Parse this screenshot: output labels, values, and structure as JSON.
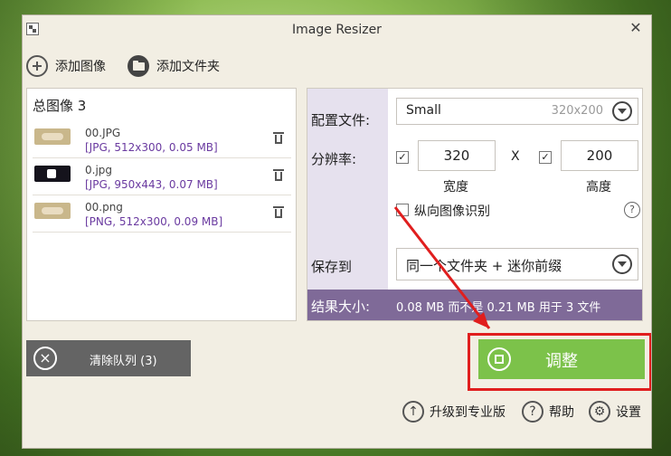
{
  "window": {
    "title": "Image Resizer",
    "close_label": "✕"
  },
  "toolbar": {
    "add_image_label": "添加图像",
    "add_folder_label": "添加文件夹"
  },
  "files": {
    "count_label": "总图像 3",
    "items": [
      {
        "name": "00.JPG",
        "meta": "[JPG, 512x300, 0.05 MB]"
      },
      {
        "name": "0.jpg",
        "meta": "[JPG, 950x443, 0.07 MB]"
      },
      {
        "name": "00.png",
        "meta": "[PNG, 512x300, 0.09 MB]"
      }
    ]
  },
  "settings": {
    "profile_label": "配置文件:",
    "profile_name": "Small",
    "profile_size": "320x200",
    "resolution_label": "分辨率:",
    "width_value": "320",
    "height_value": "200",
    "x_separator": "X",
    "width_label": "宽度",
    "height_label": "高度",
    "portrait_label": "纵向图像识别",
    "help_glyph": "?",
    "save_label": "保存到",
    "save_value": "同一个文件夹 + 迷你前缀",
    "result_label": "结果大小:",
    "result_value": "0.08 MB 而不是 0.21 MB 用于 3 文件"
  },
  "actions": {
    "clear_queue_label": "清除队列 (3)",
    "resize_label": "调整",
    "upgrade_label": "升级到专业版",
    "help_label": "帮助",
    "settings_label": "设置"
  },
  "colors": {
    "accent_green": "#7cc24a",
    "result_bar": "#7f6a98",
    "highlight_red": "#e01e1e"
  }
}
